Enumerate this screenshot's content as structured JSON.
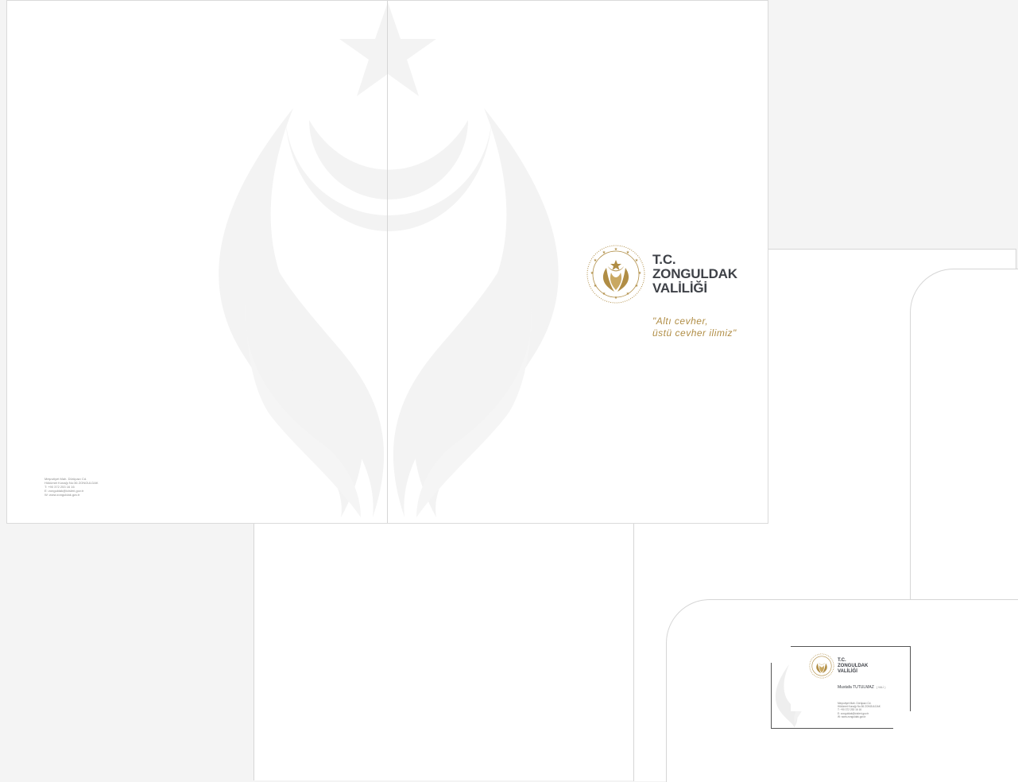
{
  "folder": {
    "brand_line_1": "T.C.",
    "brand_line_2": "ZONGULDAK",
    "brand_line_3": "VALİLİĞİ",
    "slogan_line_1": "\"Altı cevher,",
    "slogan_line_2": "üstü cevher ilimiz\"",
    "contact": [
      "Meşrutiyet Mah. Dürüpazı Cd.",
      "Hükümet Konağı No:36 ZONGULDAK",
      "T: +90 372 253 16 16",
      "E: zonguldak@icisleri.gov.tr",
      "W: www.zonguldak.gov.tr"
    ]
  },
  "business_card": {
    "brand_line_1": "T.C.",
    "brand_line_2": "ZONGULDAK",
    "brand_line_3": "VALİLİĞİ",
    "person_name": "Mustafa TUTULMAZ",
    "person_title": "( VALİ )",
    "contact": [
      "Meşrutiyet Mah. Dürüpazı Cd.",
      "Hükümet Konağı No:36 ZONGULDAK",
      "T: +90 372 253 16 16",
      "E: zonguldak@icisleri.gov.tr",
      "W: www.zonguldak.gov.tr"
    ]
  },
  "colors": {
    "background": "#f4f4f4",
    "paper": "#ffffff",
    "brand_gold": "#b08d45",
    "brand_dark": "#3e4147",
    "watermark": "#f3f3f3"
  }
}
